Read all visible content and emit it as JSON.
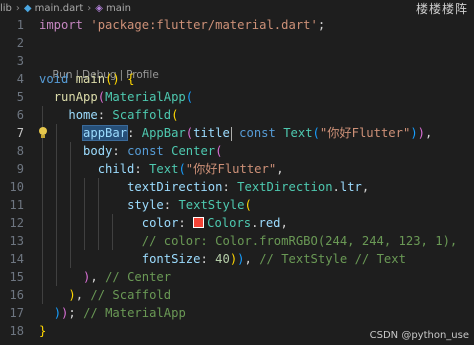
{
  "breadcrumb": {
    "prefix": "lib",
    "file": "main.dart",
    "symbol": "main"
  },
  "corner_text": "楼楼楼阵",
  "codelens": {
    "run": "Run",
    "debug": "Debug",
    "profile": "Profile"
  },
  "line_numbers": [
    "1",
    "2",
    "3",
    "4",
    "5",
    "6",
    "7",
    "8",
    "9",
    "10",
    "11",
    "12",
    "13",
    "14",
    "15",
    "16",
    "17",
    "18"
  ],
  "active_line": "6",
  "code": {
    "l1": {
      "kw": "import",
      "str": "'package:flutter/material.dart'",
      "semi": ";"
    },
    "l4": {
      "kw": "void",
      "fn": "main",
      "parens": "()",
      "brace": "{"
    },
    "l5": {
      "fn": "runApp",
      "cls": "MaterialApp"
    },
    "l6": {
      "param": "home",
      "cls": "Scaffold"
    },
    "l7": {
      "param": "appBar",
      "cls": "AppBar",
      "param2": "title",
      "kw": "const",
      "cls2": "Text",
      "str": "\"你好Flutter\""
    },
    "l8": {
      "param": "body",
      "kw": "const",
      "cls": "Center"
    },
    "l9": {
      "param": "child",
      "cls": "Text",
      "str": "\"你好Flutter\""
    },
    "l10": {
      "param": "textDirection",
      "cls": "TextDirection",
      "prop": "ltr"
    },
    "l11": {
      "param": "style",
      "cls": "TextStyle"
    },
    "l12": {
      "param": "color",
      "cls": "Colors",
      "prop": "red"
    },
    "l13": {
      "comment": "// color: Color.fromRGBO(244, 244, 123, 1),"
    },
    "l14": {
      "param": "fontSize",
      "num": "40",
      "comment": "// TextStyle // Text"
    },
    "l15": {
      "comment": "// Center"
    },
    "l16": {
      "comment": "// Scaffold"
    },
    "l17": {
      "comment": "// MaterialApp"
    }
  },
  "watermark": "CSDN @python_use",
  "colors": {
    "swatch": "#f44336",
    "background": "#1e1e1e"
  }
}
